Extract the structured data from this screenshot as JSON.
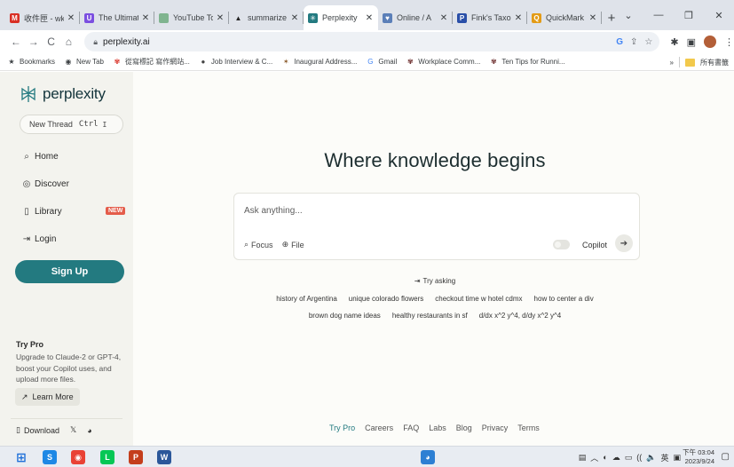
{
  "browser": {
    "tabs": [
      {
        "title": "收件匣 - wk",
        "favicon": "gmail-icon",
        "color": "#d93025",
        "glyph": "M",
        "active": false
      },
      {
        "title": "The Ultimate",
        "favicon": "circle-logo-icon",
        "color": "#7b4fe0",
        "glyph": "U",
        "active": false
      },
      {
        "title": "YouTube To",
        "favicon": "green-square-icon",
        "color": "#7fb48f",
        "glyph": "",
        "active": false
      },
      {
        "title": "summarize",
        "favicon": "triangle-icon",
        "color": "#222222",
        "glyph": "▲",
        "active": false
      },
      {
        "title": "Perplexity",
        "favicon": "perplexity-icon",
        "color": "#237a80",
        "glyph": "✳",
        "active": true
      },
      {
        "title": "Online / A",
        "favicon": "wing-icon",
        "color": "#5b7fb8",
        "glyph": "♥",
        "active": false
      },
      {
        "title": "Fink's Taxo",
        "favicon": "p-letter-icon",
        "color": "#2a4fa8",
        "glyph": "P",
        "active": false
      },
      {
        "title": "QuickMark",
        "favicon": "quickmark-icon",
        "color": "#e39b16",
        "glyph": "Q",
        "active": false
      }
    ],
    "new_tab": "+",
    "window_controls": {
      "dropdown": "⌄",
      "minimize": "—",
      "maximize": "❐",
      "close": "✕"
    },
    "address": "perplexity.ai",
    "bookmarks": [
      {
        "label": "Bookmarks",
        "icon": "star-icon",
        "glyph": "★",
        "color": "#3c4043"
      },
      {
        "label": "New Tab",
        "icon": "globe-icon",
        "glyph": "◉",
        "color": "#3c4043"
      },
      {
        "label": "從寫標記 寫作網站...",
        "icon": "flower-icon",
        "glyph": "✾",
        "color": "#d93025"
      },
      {
        "label": "Job Interview & C...",
        "icon": "dark-circle-icon",
        "glyph": "●",
        "color": "#444"
      },
      {
        "label": "Inaugural Address...",
        "icon": "seal-icon",
        "glyph": "✶",
        "color": "#8a5a2b"
      },
      {
        "label": "Gmail",
        "icon": "google-icon",
        "glyph": "G",
        "color": "#4285f4"
      },
      {
        "label": "Workplace Comm...",
        "icon": "flower-icon",
        "glyph": "✾",
        "color": "#6b2b2b"
      },
      {
        "label": "Ten Tips for Runni...",
        "icon": "flower-icon",
        "glyph": "✾",
        "color": "#6b2b2b"
      }
    ],
    "bookmarks_overflow": "»",
    "bookmarks_folder": "所有書籤"
  },
  "sidebar": {
    "logo_text": "perplexity",
    "new_thread": {
      "label": "New Thread",
      "key1": "Ctrl",
      "key2": "I"
    },
    "nav": [
      {
        "label": "Home",
        "icon": "search-icon",
        "glyph": "⌕",
        "name": "home"
      },
      {
        "label": "Discover",
        "icon": "compass-icon",
        "glyph": "◎",
        "name": "discover"
      },
      {
        "label": "Library",
        "icon": "library-icon",
        "glyph": "▯",
        "name": "library"
      },
      {
        "label": "Login",
        "icon": "login-icon",
        "glyph": "⇥",
        "name": "login"
      }
    ],
    "library_badge": "NEW",
    "signup_label": "Sign Up",
    "try_pro": {
      "title": "Try Pro",
      "desc": "Upgrade to Claude-2 or GPT-4, boost your Copilot uses, and upload more files.",
      "button": "Learn More"
    },
    "footer": {
      "download": "Download",
      "x_glyph": "𝕏",
      "discord_glyph": "◕"
    }
  },
  "main": {
    "headline": "Where knowledge begins",
    "search": {
      "placeholder": "Ask anything...",
      "focus_label": "Focus",
      "file_label": "File",
      "copilot_label": "Copilot",
      "copilot_on": false
    },
    "try_asking": "Try asking",
    "suggestions_row1": [
      "history of Argentina",
      "unique colorado flowers",
      "checkout time w hotel cdmx",
      "how to center a div"
    ],
    "suggestions_row2": [
      "brown dog name ideas",
      "healthy restaurants in sf",
      "d/dx x^2 y^4, d/dy x^2 y^4"
    ],
    "footer_links": [
      "Try Pro",
      "Careers",
      "FAQ",
      "Labs",
      "Blog",
      "Privacy",
      "Terms"
    ]
  },
  "taskbar": {
    "apps": [
      {
        "name": "windows-start-icon",
        "color": "#1e6fd9",
        "glyph": "⊞"
      },
      {
        "name": "skype-icon",
        "color": "#1e88e5",
        "glyph": "S"
      },
      {
        "name": "chrome-icon",
        "color": "#e94235",
        "glyph": "◉"
      },
      {
        "name": "line-icon",
        "color": "#06c755",
        "glyph": "L"
      },
      {
        "name": "powerpoint-icon",
        "color": "#c43e1c",
        "glyph": "P"
      },
      {
        "name": "word-icon",
        "color": "#2b579a",
        "glyph": "W"
      },
      {
        "name": "app-center-icon",
        "color": "#2d7fd3",
        "glyph": "◕"
      }
    ],
    "tray": [
      "▤",
      "︿",
      "◐",
      "☁",
      "▭",
      "((",
      "🔈",
      "英",
      "▣"
    ],
    "ime_label": "英",
    "time": "下午 03:04",
    "date": "2023/9/24",
    "notification_glyph": "▢"
  }
}
